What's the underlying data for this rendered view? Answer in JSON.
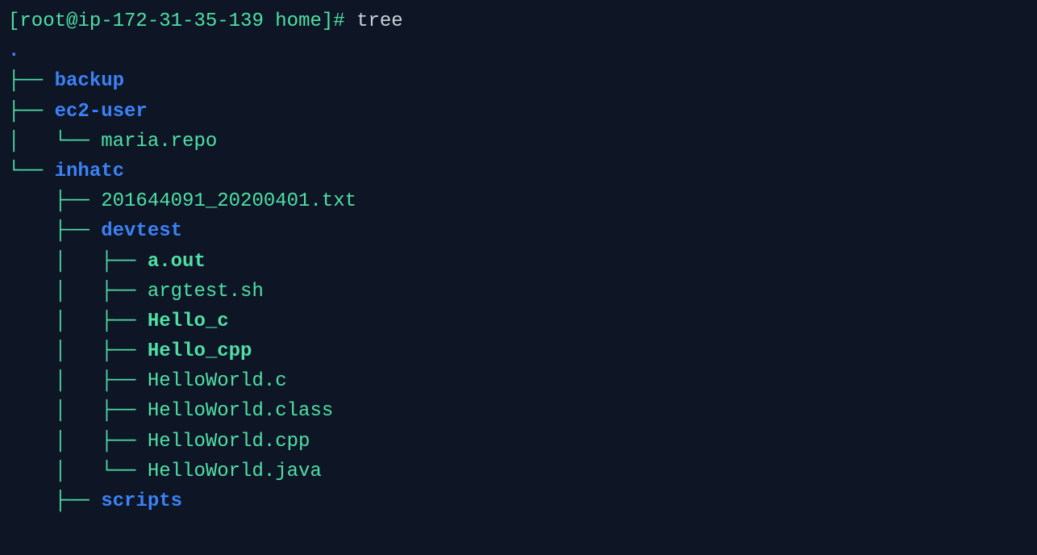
{
  "prompt": {
    "open": "[",
    "user": "root@ip-172-31-35-139",
    "space": " ",
    "cwd": "home",
    "close": "]#",
    "command": "tree"
  },
  "dot": ".",
  "tree": {
    "l1": {
      "pipe": "├── ",
      "name": "backup"
    },
    "l2": {
      "pipe": "├── ",
      "name": "ec2-user"
    },
    "l3": {
      "pipe": "│   └── ",
      "name": "maria.repo"
    },
    "l4": {
      "pipe": "└── ",
      "name": "inhatc"
    },
    "l5": {
      "pipe": "    ├── ",
      "name": "201644091_20200401.txt"
    },
    "l6": {
      "pipe": "    ├── ",
      "name": "devtest"
    },
    "l7": {
      "pipe": "    │   ├── ",
      "name": "a.out"
    },
    "l8": {
      "pipe": "    │   ├── ",
      "name": "argtest.sh"
    },
    "l9": {
      "pipe": "    │   ├── ",
      "name": "Hello_c"
    },
    "l10": {
      "pipe": "    │   ├── ",
      "name": "Hello_cpp"
    },
    "l11": {
      "pipe": "    │   ├── ",
      "name": "HelloWorld.c"
    },
    "l12": {
      "pipe": "    │   ├── ",
      "name": "HelloWorld.class"
    },
    "l13": {
      "pipe": "    │   ├── ",
      "name": "HelloWorld.cpp"
    },
    "l14": {
      "pipe": "    │   └── ",
      "name": "HelloWorld.java"
    },
    "l15": {
      "pipe": "    ├── ",
      "name": "scripts"
    }
  }
}
